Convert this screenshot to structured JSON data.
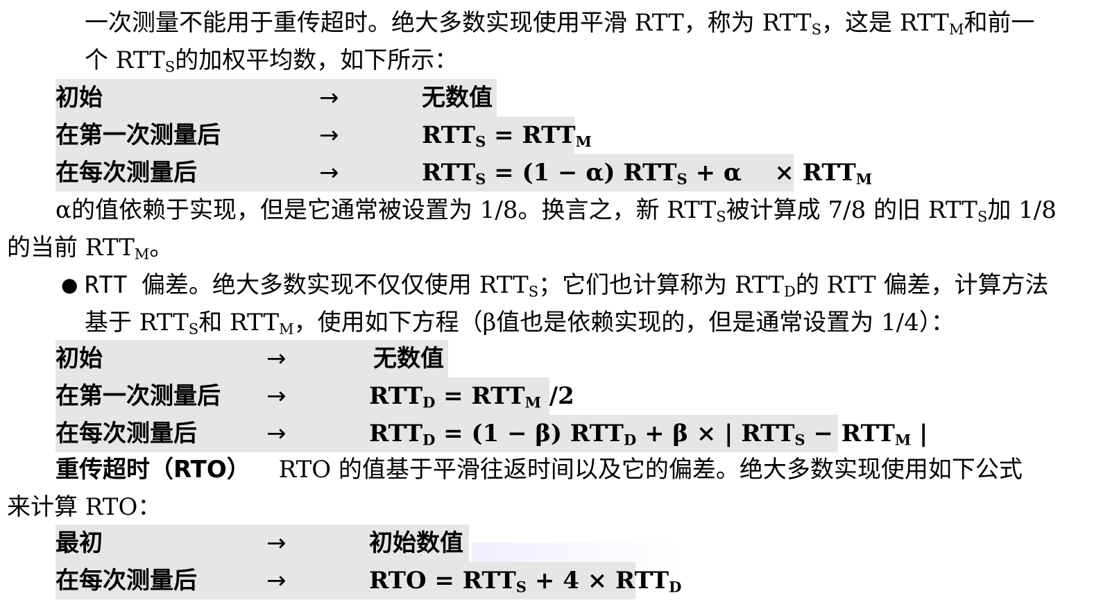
{
  "p1": {
    "a": "一次测量不能用于重传超时。绝大多数实现使用平滑 RTT，称为 RTT",
    "a_sub": "S",
    "b": "，这是 RTT",
    "b_sub": "M",
    "c": "和前一",
    "d": "个 RTT",
    "d_sub": "S",
    "e": "的加权平均数，如下所示："
  },
  "table1": {
    "r1": {
      "label": "初始",
      "arrow": "→",
      "value": "无数值"
    },
    "r2": {
      "label": "在第一次测量后",
      "arrow": "→",
      "v1": "RTT",
      "v1sub": "S",
      "v2": " = RTT",
      "v2sub": "M"
    },
    "r3": {
      "label": "在每次测量后",
      "arrow": "→",
      "v1": "RTT",
      "v1sub": "S",
      "v2": " = (1 − α) RTT",
      "v2sub": "S",
      "v3": " + α    × RTT",
      "v3sub": "M"
    }
  },
  "p2": {
    "a": "α的值依赖于实现，但是它通常被设置为 1/8。换言之，新 RTT",
    "a_sub": "S",
    "b": "被计算成 7/8 的旧 RTT",
    "b_sub": "S",
    "c": "加 1/8",
    "d": "的当前 RTT",
    "d_sub": "M",
    "e": "。"
  },
  "bullet": {
    "symbol": "●",
    "term": "RTT 偏差",
    "a": "。绝大多数实现不仅仅使用 RTT",
    "a_sub": "S",
    "b": "；它们也计算称为 RTT",
    "b_sub": "D",
    "c": "的 RTT 偏差，计算方法",
    "d": "基于 RTT",
    "d_sub": "S",
    "e": "和 RTT",
    "e_sub": "M",
    "f": "，使用如下方程（β值也是依赖实现的，但是通常设置为 1/4）："
  },
  "table2": {
    "r1": {
      "label": "初始",
      "arrow": "→",
      "value": "无数值"
    },
    "r2": {
      "label": "在第一次测量后",
      "arrow": "→",
      "v1": "RTT",
      "v1sub": "D",
      "v2": " = RTT",
      "v2sub": "M",
      "v3": " /2"
    },
    "r3": {
      "label": "在每次测量后",
      "arrow": "→",
      "v1": "RTT",
      "v1sub": "D",
      "v2": " = (1 − β) RTT",
      "v2sub": "D",
      "v3": " + β × | RTT",
      "v3sub": "S",
      "v4": " − RTT",
      "v4sub": "M",
      "v5": " |"
    }
  },
  "p3": {
    "term": "重传超时（RTO）",
    "a": "RTO  的值基于平滑往返时间以及它的偏差。绝大多数实现使用如下公式",
    "b": "来计算 RTO："
  },
  "table3": {
    "r1": {
      "label": "最初",
      "arrow": "→",
      "value": "初始数值"
    },
    "r2": {
      "label": "在每次测量后",
      "arrow": "→",
      "v1": "RTO = RTT",
      "v1sub": "S",
      "v2": " + 4 × RTT",
      "v2sub": "D"
    }
  }
}
